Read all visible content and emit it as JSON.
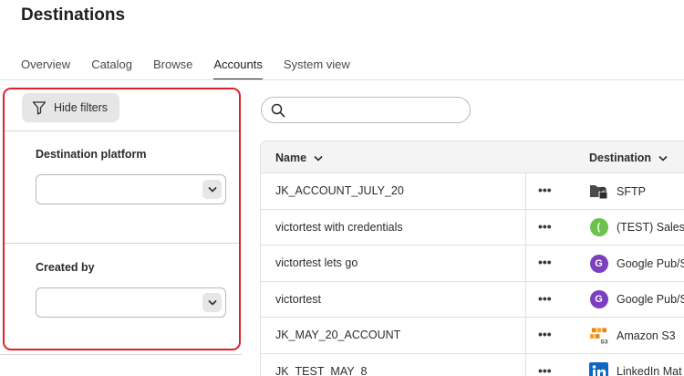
{
  "page": {
    "title": "Destinations"
  },
  "tabs": [
    {
      "label": "Overview",
      "active": false
    },
    {
      "label": "Catalog",
      "active": false
    },
    {
      "label": "Browse",
      "active": false
    },
    {
      "label": "Accounts",
      "active": true
    },
    {
      "label": "System view",
      "active": false
    }
  ],
  "filters": {
    "hide_label": "Hide filters",
    "platform_label": "Destination platform",
    "platform_value": "",
    "created_by_label": "Created by",
    "created_by_value": ""
  },
  "search": {
    "placeholder": "",
    "value": ""
  },
  "table": {
    "columns": {
      "name": "Name",
      "destination": "Destination"
    },
    "more_glyph": "•••",
    "rows": [
      {
        "name": "JK_ACCOUNT_JULY_20",
        "destination": "SFTP",
        "icon": "sftp-folder-lock-icon"
      },
      {
        "name": "victortest with credentials",
        "destination": "(TEST) Salesf",
        "icon": "salesforce-circle-icon",
        "icon_letter": "(",
        "icon_color": "#6cc24a"
      },
      {
        "name": "victortest lets go",
        "destination": "Google Pub/S",
        "icon": "google-pubsub-circle-icon",
        "icon_letter": "G",
        "icon_color": "#7b3fbf"
      },
      {
        "name": "victortest",
        "destination": "Google Pub/S",
        "icon": "google-pubsub-circle-icon",
        "icon_letter": "G",
        "icon_color": "#7b3fbf"
      },
      {
        "name": "JK_MAY_20_ACCOUNT",
        "destination": "Amazon S3",
        "icon": "amazon-s3-icon"
      },
      {
        "name": "JK_TEST_MAY_8",
        "destination": "LinkedIn Mat",
        "icon": "linkedin-icon"
      }
    ]
  }
}
